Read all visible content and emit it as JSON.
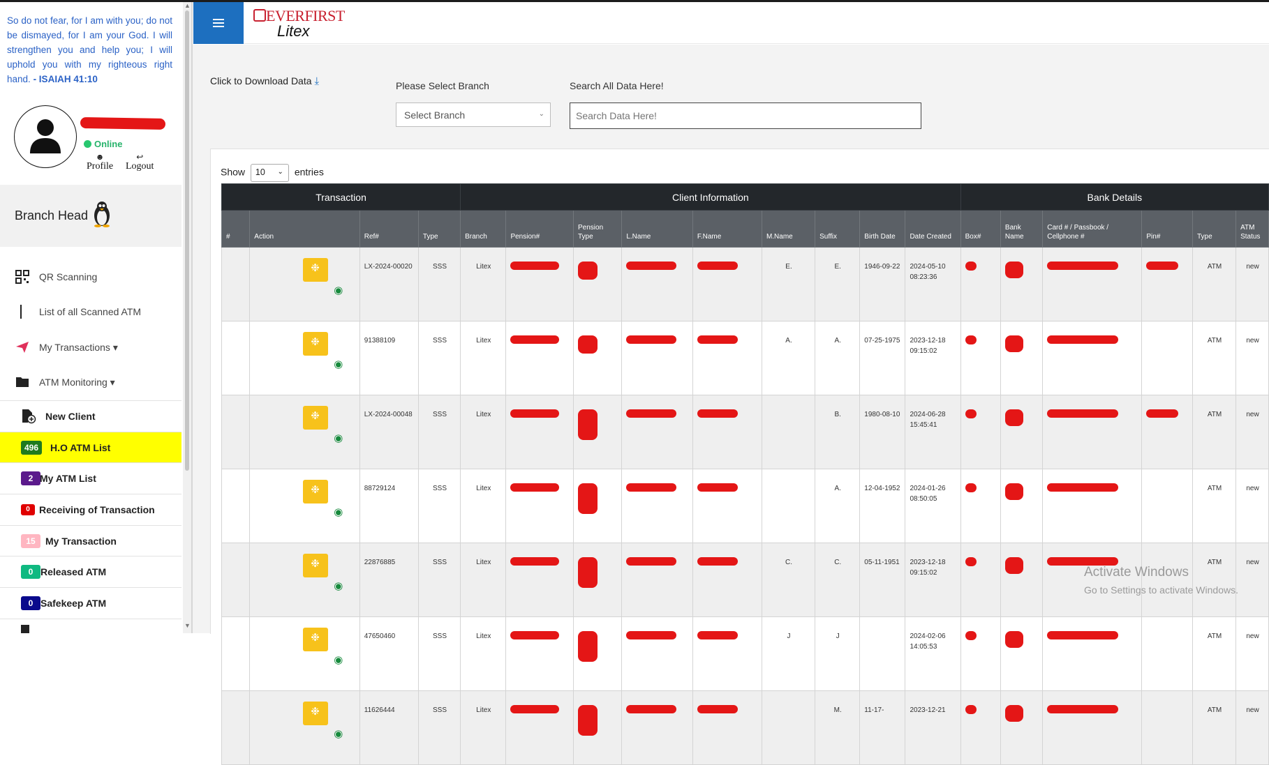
{
  "sidebar": {
    "verse_text": "So do not fear, for I am with you; do not be dismayed, for I am your God. I will strengthen you and help you; I will uphold you with my righteous right hand.",
    "verse_ref": "- ISAIAH 41:10",
    "status": "Online",
    "profile_label": "Profile",
    "logout_label": "Logout",
    "role": "Branch Head",
    "nav": [
      {
        "label": "QR Scanning",
        "icon": "qr-icon"
      },
      {
        "label": "List of all Scanned ATM",
        "icon": "bar-icon"
      },
      {
        "label": "My Transactions ▾",
        "icon": "paper-plane-icon"
      },
      {
        "label": "ATM Monitoring ▾",
        "icon": "folder-icon"
      }
    ],
    "submenu": [
      {
        "label": "New Client",
        "badge": "",
        "color": ""
      },
      {
        "label": "H.O ATM List",
        "badge": "496",
        "color": "#1f7a1f"
      },
      {
        "label": "My ATM List",
        "badge": "2",
        "color": "#5b1a8c"
      },
      {
        "label": "Receiving of Transaction",
        "badge": "0",
        "color": "#e00000"
      },
      {
        "label": "My Transaction",
        "badge": "15",
        "color": "#ffb6c1"
      },
      {
        "label": "Released ATM",
        "badge": "0",
        "color": "#10b981"
      },
      {
        "label": "Safekeep ATM",
        "badge": "0",
        "color": "#0a0a8c"
      }
    ]
  },
  "header": {
    "brand": "EVERFIRST",
    "sub": "Litex"
  },
  "controls": {
    "download_label": "Click to Download Data",
    "branch_label": "Please Select Branch",
    "branch_value": "Select Branch",
    "search_label": "Search All Data Here!",
    "search_placeholder": "Search Data Here!",
    "show_label": "Show",
    "entries_value": "10",
    "entries_label": "entries"
  },
  "table": {
    "groups": [
      "Transaction",
      "Client Information",
      "Bank Details"
    ],
    "columns": [
      "#",
      "Action",
      "Ref#",
      "Type",
      "Branch",
      "Pension#",
      "Pension Type",
      "L.Name",
      "F.Name",
      "M.Name",
      "Suffix",
      "Birth Date",
      "Date Created",
      "Box#",
      "Bank Name",
      "Card # / Passbook / Cellphone #",
      "Pin#",
      "Type",
      "ATM Status"
    ],
    "rows": [
      {
        "ref": "LX-2024-00020",
        "type": "SSS",
        "branch": "Litex",
        "mname": "E.",
        "suffix": "E.",
        "birth": "1946-09-22",
        "created": "2024-05-10 08:23:36",
        "btype": "ATM",
        "status": "new"
      },
      {
        "ref": "91388109",
        "type": "SSS",
        "branch": "Litex",
        "mname": "A.",
        "suffix": "A.",
        "birth": "07-25-1975",
        "created": "2023-12-18 09:15:02",
        "btype": "ATM",
        "status": "new"
      },
      {
        "ref": "LX-2024-00048",
        "type": "SSS",
        "branch": "Litex",
        "mname": "",
        "suffix": "B.",
        "birth": "1980-08-10",
        "created": "2024-06-28 15:45:41",
        "btype": "ATM",
        "status": "new"
      },
      {
        "ref": "88729124",
        "type": "SSS",
        "branch": "Litex",
        "mname": "",
        "suffix": "A.",
        "birth": "12-04-1952",
        "created": "2024-01-26 08:50:05",
        "btype": "ATM",
        "status": "new"
      },
      {
        "ref": "22876885",
        "type": "SSS",
        "branch": "Litex",
        "mname": "C.",
        "suffix": "C.",
        "birth": "05-11-1951",
        "created": "2023-12-18 09:15:02",
        "btype": "ATM",
        "status": "new"
      },
      {
        "ref": "47650460",
        "type": "SSS",
        "branch": "Litex",
        "mname": "J",
        "suffix": "J",
        "birth": "",
        "created": "2024-02-06 14:05:53",
        "btype": "ATM",
        "status": "new"
      },
      {
        "ref": "11626444",
        "type": "SSS",
        "branch": "Litex",
        "mname": "",
        "suffix": "M.",
        "birth": "11-17-",
        "created": "2023-12-21",
        "btype": "ATM",
        "status": "new"
      }
    ]
  },
  "watermark": {
    "line1": "Activate Windows",
    "line2": "Go to Settings to activate Windows."
  }
}
